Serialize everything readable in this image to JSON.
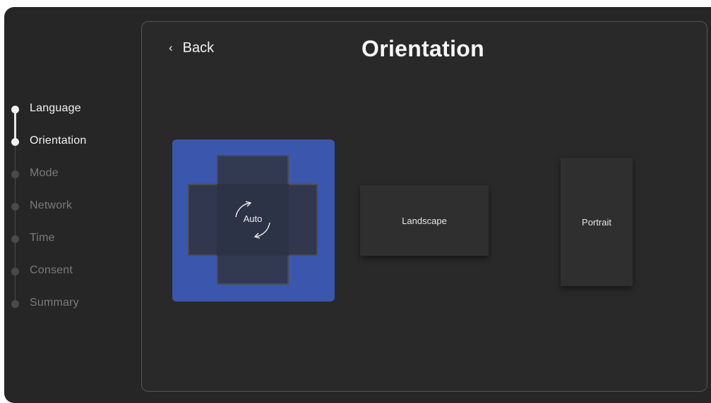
{
  "sidebar": {
    "steps": [
      {
        "label": "Language",
        "state": "done"
      },
      {
        "label": "Orientation",
        "state": "current"
      },
      {
        "label": "Mode",
        "state": "pending"
      },
      {
        "label": "Network",
        "state": "pending"
      },
      {
        "label": "Time",
        "state": "pending"
      },
      {
        "label": "Consent",
        "state": "pending"
      },
      {
        "label": "Summary",
        "state": "pending"
      }
    ]
  },
  "header": {
    "back_label": "Back",
    "back_icon": "chevron-left-icon",
    "title": "Orientation"
  },
  "options": {
    "auto": {
      "label": "Auto",
      "selected": true,
      "icon": "rotate-arrows-icon"
    },
    "landscape": {
      "label": "Landscape",
      "selected": false
    },
    "portrait": {
      "label": "Portrait",
      "selected": false
    }
  },
  "colors": {
    "background": "#262626",
    "accent": "#3b56ad",
    "text": "#f2f2f2",
    "muted": "#7a7a7a"
  }
}
